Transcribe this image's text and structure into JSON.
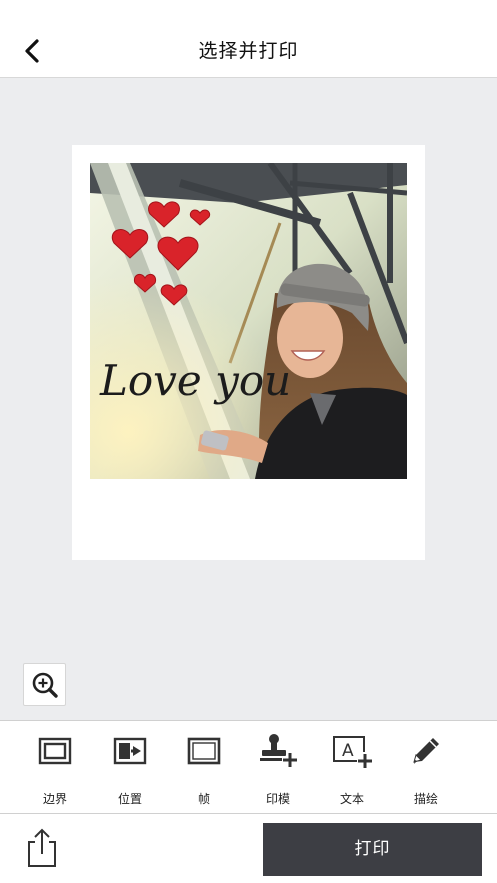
{
  "header": {
    "title": "选择并打印"
  },
  "photo": {
    "overlay_text": "Love you"
  },
  "toolbar": {
    "items": [
      {
        "label": "边界",
        "icon": "border-icon"
      },
      {
        "label": "位置",
        "icon": "position-icon"
      },
      {
        "label": "帧",
        "icon": "frame-icon"
      },
      {
        "label": "印模",
        "icon": "stamp-add-icon"
      },
      {
        "label": "文本",
        "icon": "text-add-icon"
      },
      {
        "label": "描绘",
        "icon": "pencil-icon"
      }
    ]
  },
  "footer": {
    "print_label": "打印"
  },
  "colors": {
    "accent": "#3d3e44",
    "canvas_bg": "#ecedef",
    "heart": "#d9232a"
  }
}
